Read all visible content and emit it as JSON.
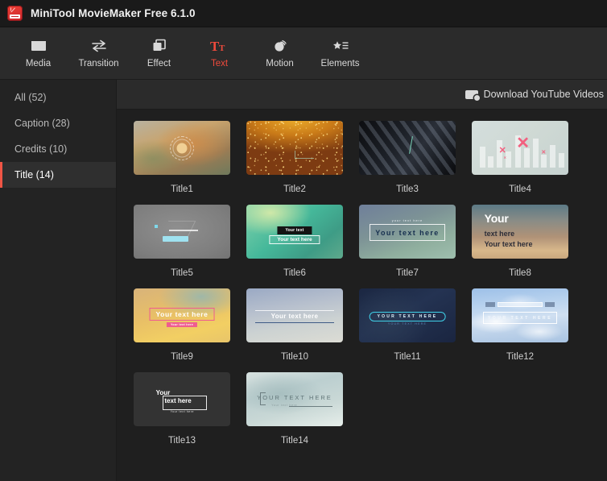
{
  "window": {
    "title": "MiniTool MovieMaker Free 6.1.0",
    "icon": "app-logo-icon"
  },
  "toolbar": {
    "items": [
      {
        "label": "Media",
        "icon": "folder-icon",
        "active": false
      },
      {
        "label": "Transition",
        "icon": "swap-arrows-icon",
        "active": false
      },
      {
        "label": "Effect",
        "icon": "layers-icon",
        "active": false
      },
      {
        "label": "Text",
        "icon": "text-tt-icon",
        "active": true
      },
      {
        "label": "Motion",
        "icon": "motion-circle-icon",
        "active": false
      },
      {
        "label": "Elements",
        "icon": "star-list-icon",
        "active": false
      }
    ],
    "active_color": "#ef4a3c",
    "inactive_color": "#d8d8d8"
  },
  "sidebar": {
    "items": [
      {
        "label": "All (52)",
        "active": false
      },
      {
        "label": "Caption (28)",
        "active": false
      },
      {
        "label": "Credits (10)",
        "active": false
      },
      {
        "label": "Title (14)",
        "active": true
      }
    ],
    "active_marker_color": "#f05545"
  },
  "content_header": {
    "download_button": {
      "label": "Download YouTube Videos",
      "icon": "video-download-icon"
    }
  },
  "gallery": {
    "items": [
      {
        "caption": "Title1",
        "art": "t1",
        "texts": []
      },
      {
        "caption": "Title2",
        "art": "t2",
        "texts": []
      },
      {
        "caption": "Title3",
        "art": "t3",
        "texts": []
      },
      {
        "caption": "Title4",
        "art": "t4",
        "texts": []
      },
      {
        "caption": "Title5",
        "art": "t5",
        "texts": []
      },
      {
        "caption": "Title6",
        "art": "t6",
        "texts": [
          "Your text",
          "Your text here"
        ]
      },
      {
        "caption": "Title7",
        "art": "t7",
        "texts": [
          "your text here",
          "Your text here"
        ]
      },
      {
        "caption": "Title8",
        "art": "t8",
        "texts": [
          "Your",
          "text here",
          "Your text here"
        ]
      },
      {
        "caption": "Title9",
        "art": "t9",
        "texts": [
          "Your text here",
          "Your text here"
        ]
      },
      {
        "caption": "Title10",
        "art": "t10",
        "texts": [
          "Your text here"
        ]
      },
      {
        "caption": "Title11",
        "art": "t11",
        "texts": [
          "YOUR TEXT HERE",
          "YOUR TEXT HERE"
        ]
      },
      {
        "caption": "Title12",
        "art": "t12",
        "texts": [
          "YOUR TEXT HERE"
        ]
      },
      {
        "caption": "Title13",
        "art": "t13",
        "texts": [
          "Your",
          "text here",
          "Your text here"
        ]
      },
      {
        "caption": "Title14",
        "art": "t14",
        "texts": [
          "YOUR TEXT HERE",
          "Your text here"
        ]
      }
    ]
  },
  "thumb_text": {
    "t6_banner": "Your text",
    "t6_ribbon": "Your text here",
    "t7_sub": "your text here",
    "t7_main": "Your text here",
    "t8_l1": "Your",
    "t8_l2": "text here",
    "t8_l3": "Your text here",
    "t9_main": "Your text here",
    "t9_sub": "Your text here",
    "t10_main": "Your text here",
    "t11_main": "YOUR TEXT HERE",
    "t11_sub": "YOUR TEXT HERE",
    "t12_main": "YOUR TEXT HERE",
    "t13_w1": "Your",
    "t13_w2": "text here",
    "t13_w3": "Your text here",
    "t14_main": "YOUR TEXT HERE",
    "t14_sub": "Your text here"
  }
}
